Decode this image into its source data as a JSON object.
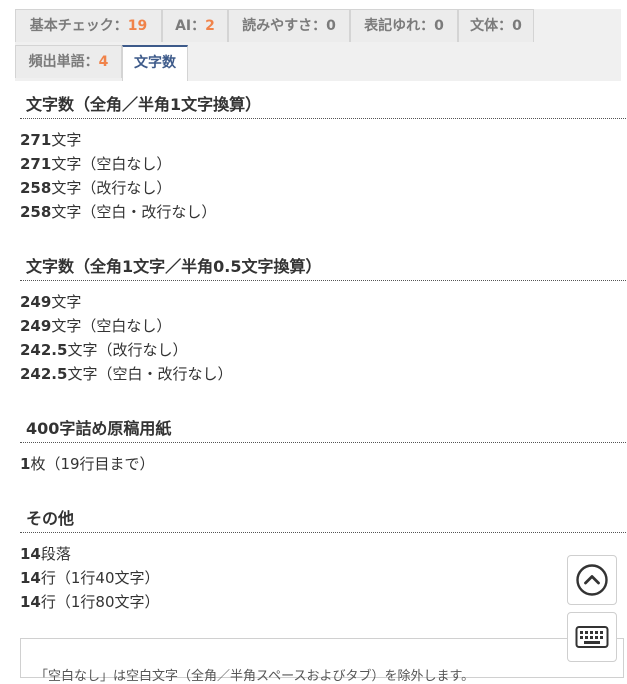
{
  "tabs": [
    {
      "label": "基本チェック：",
      "count": "19"
    },
    {
      "label": "AI：",
      "count": "2"
    },
    {
      "label": "読みやすさ：",
      "count": "0"
    },
    {
      "label": "表記ゆれ：",
      "count": "0"
    },
    {
      "label": "文体：",
      "count": "0"
    },
    {
      "label": "頻出単語：",
      "count": "4"
    },
    {
      "label": "文字数",
      "count": ""
    }
  ],
  "sections": {
    "half1": {
      "heading": "文字数（全角／半角1文字換算）",
      "rows": [
        {
          "value": "271",
          "text": "文字"
        },
        {
          "value": "271",
          "text": "文字（空白なし）"
        },
        {
          "value": "258",
          "text": "文字（改行なし）"
        },
        {
          "value": "258",
          "text": "文字（空白・改行なし）"
        }
      ]
    },
    "half05": {
      "heading": "文字数（全角1文字／半角0.5文字換算）",
      "rows": [
        {
          "value": "249",
          "text": "文字"
        },
        {
          "value": "249",
          "text": "文字（空白なし）"
        },
        {
          "value": "242.5",
          "text": "文字（改行なし）"
        },
        {
          "value": "242.5",
          "text": "文字（空白・改行なし）"
        }
      ]
    },
    "genko": {
      "heading": "400字詰め原稿用紙",
      "rows": [
        {
          "value": "1",
          "text": "枚（19行目まで）"
        }
      ]
    },
    "other": {
      "heading": "その他",
      "rows": [
        {
          "value": "14",
          "text": "段落"
        },
        {
          "value": "14",
          "text": "行（1行40文字）"
        },
        {
          "value": "14",
          "text": "行（1行80文字）"
        }
      ]
    }
  },
  "note": "「空白なし」は空白文字（全角／半角スペースおよびタブ）を除外します。",
  "icons": {
    "scroll_top": "chevron-up-circle-icon",
    "keyboard": "keyboard-icon"
  }
}
